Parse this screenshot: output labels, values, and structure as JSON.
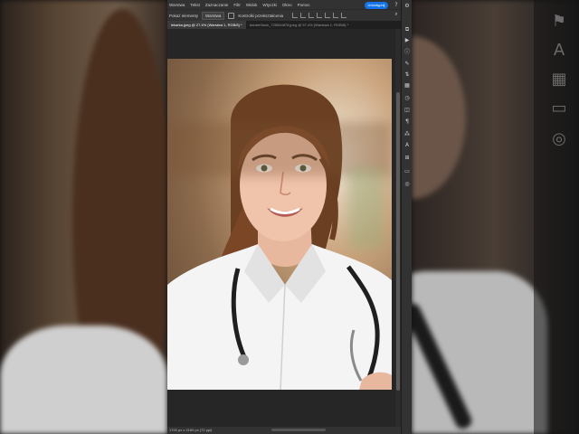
{
  "menubar": {
    "items": [
      "Warstwa",
      "Tekst",
      "Zaznaczanie",
      "Filtr",
      "Widok",
      "Wtyczki",
      "Okno",
      "Pomoc"
    ]
  },
  "options": {
    "left_label": "Pokaż elementy",
    "select_value": "Warstwa",
    "checkbox_label": "Kontrolki przekształcenia",
    "share_label": "Udostępnij"
  },
  "tabs": [
    {
      "label": "lekarka.jpeg @ 27.4% (Warstwa 1, RGB/8) *",
      "active": true
    },
    {
      "label": "AdobeStock_725544878.jpeg @ 57.4% (Warstwa 1, RGB/8) *",
      "active": false
    }
  ],
  "status": {
    "text": "1700 px x 2160 px (72 ppi)"
  },
  "photo": {
    "description_subject": "doctor-portrait"
  },
  "colors": {
    "app_bg": "#282828",
    "panel": "#323232",
    "accent": "#1473e6"
  },
  "icons": {
    "right_toolbar": [
      "layers-icon",
      "play-icon",
      "info-icon",
      "brush-icon",
      "adjust-icon",
      "swatches-icon",
      "history-icon",
      "properties-icon",
      "paragraph-icon",
      "character-icon",
      "glyph-icon",
      "libraries-icon",
      "comment-icon"
    ],
    "top": [
      "help-icon",
      "search-icon",
      "settings-icon"
    ]
  }
}
